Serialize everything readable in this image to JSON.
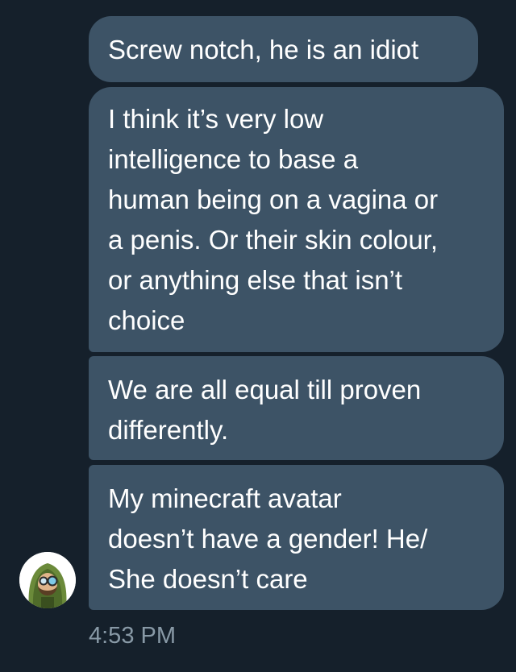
{
  "conversation": {
    "messages": [
      {
        "text": "Screw notch, he is an idiot"
      },
      {
        "text": "I think it’s very low\nintelligence to base a\nhuman being on a vagina or\na penis. Or their skin colour,\nor anything else that isn’t\nchoice"
      },
      {
        "text": "We are all equal till proven\ndifferently."
      },
      {
        "text": "My minecraft avatar\ndoesn’t have a gender! He/\nShe doesn’t care"
      }
    ],
    "timestamp": "4:53 PM",
    "sender_avatar": {
      "icon": "hooded-cartoon-character-avatar-icon"
    }
  },
  "colors": {
    "background": "#15202b",
    "bubble": "#3d5366",
    "text": "#ffffff",
    "timestamp": "#8899a6"
  }
}
